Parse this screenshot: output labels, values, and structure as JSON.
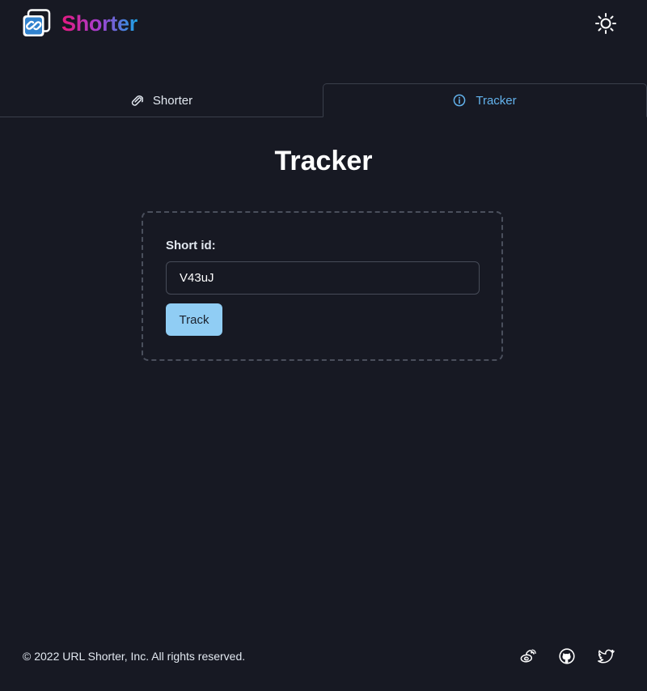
{
  "header": {
    "brand": "Shorter",
    "logo_icon": "link-icon",
    "theme_icon": "sun-icon"
  },
  "tabs": [
    {
      "label": "Shorter",
      "icon": "paperclip-icon",
      "active": false
    },
    {
      "label": "Tracker",
      "icon": "info-icon",
      "active": true
    }
  ],
  "tracker": {
    "title": "Tracker",
    "field_label": "Short id:",
    "input_value": "V43uJ",
    "button_label": "Track"
  },
  "footer": {
    "copyright": "© 2022 URL Shorter, Inc. All rights reserved.",
    "social": [
      "weibo-icon",
      "github-icon",
      "twitter-icon"
    ]
  },
  "colors": {
    "background": "#171923",
    "accent": "#63b3ed",
    "button": "#90cdf4",
    "brand_gradient": [
      "#e6197f",
      "#a33fd0",
      "#1ba3e4"
    ]
  }
}
